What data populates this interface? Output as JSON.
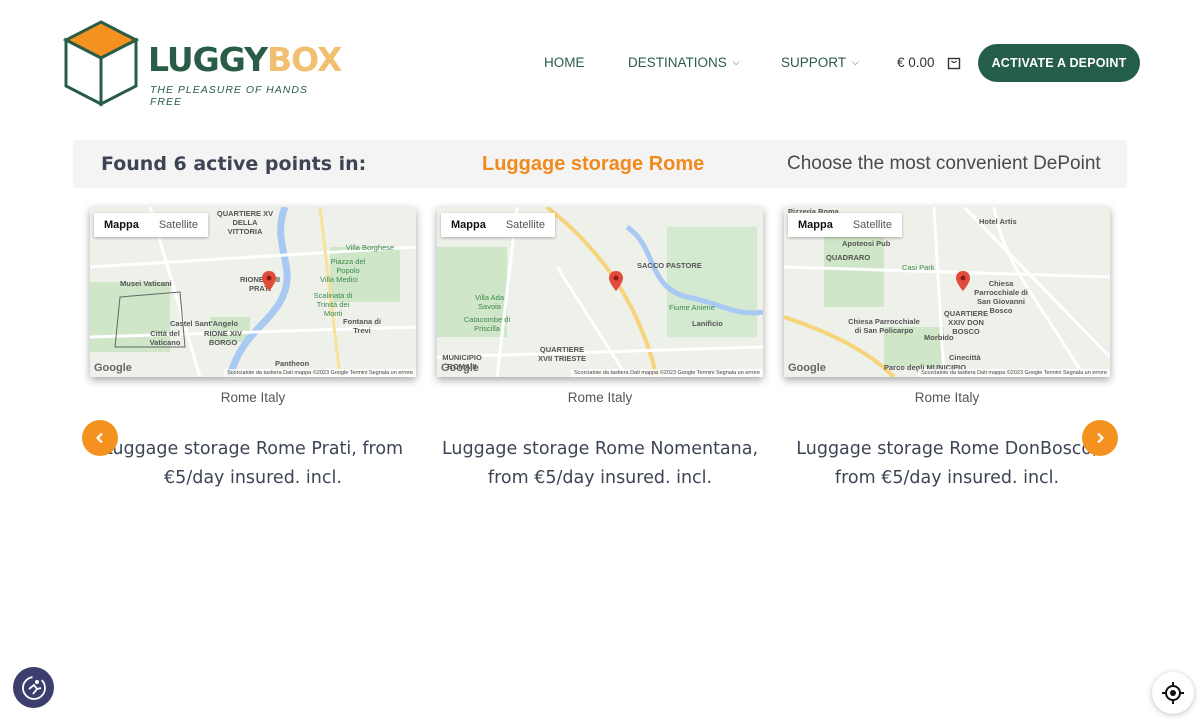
{
  "brand": {
    "name_main": "LUGGY",
    "name_accent": "BOX",
    "tagline": "THE PLEASURE OF HANDS FREE"
  },
  "nav": {
    "home": "HOME",
    "destinations": "DESTINATIONS",
    "support": "SUPPORT",
    "cart_total": "€ 0.00",
    "cta": "ACTIVATE A DEPOINT"
  },
  "banner": {
    "found": "Found 6 active points in:",
    "city": "Luggage storage Rome",
    "choose": "Choose the most convenient DePoint"
  },
  "map_controls": {
    "map": "Mappa",
    "satellite": "Satellite",
    "google": "Google",
    "attribution": "Scorciatoie da tastiera   Dati mappa ©2023 Google   Termini   Segnala un errore"
  },
  "cards": [
    {
      "location": "Rome Italy",
      "title": "Luggage storage Rome Prati, from €5/day insured. incl.",
      "labels": [
        "QUARTIERE XV DELLA VITTORIA",
        "RIONE XXII PRATI",
        "Musei Vaticani",
        "Città del Vaticano",
        "Castel Sant'Angelo",
        "RIONE XIV BORGO",
        "Pantheon",
        "Fontana di Trevi",
        "Villa Borghese",
        "Piazza del Popolo",
        "Scalinata di Trinità dei Monti",
        "Villa Medici"
      ]
    },
    {
      "location": "Rome Italy",
      "title": "Luggage storage Rome Nomentana, from €5/day insured. incl.",
      "labels": [
        "SACCO PASTORE",
        "Villa Ada Savoia",
        "Catacombe di Priscilla",
        "Lanificio",
        "QUARTIERE XVII TRIESTE",
        "MUNICIPIO ROMA II",
        "Fiume Aniene"
      ]
    },
    {
      "location": "Rome Italy",
      "title": "Luggage storage Rome DonBosco, from €5/day insured. incl.",
      "labels": [
        "Pizzeria Roma",
        "Hotel Artis",
        "Apoteosi Pub",
        "QUADRARO",
        "Casi Park",
        "Chiesa Parrocchiale di San Giovanni Bosco",
        "Chiesa Parrocchiale di San Policarpo",
        "QUARTIERE XXIV DON BOSCO",
        "Morbido",
        "Cinecittà",
        "Parco degli MUNICIPIO"
      ]
    }
  ],
  "colors": {
    "brand_green": "#255e48",
    "accent_orange": "#f5911e",
    "banner_bg": "#f4f4f4"
  },
  "icons": {
    "cart": "shopping-bag-icon",
    "prev": "chevron-left-icon",
    "next": "chevron-right-icon",
    "accessibility": "accessibility-icon",
    "locate": "crosshair-icon"
  }
}
